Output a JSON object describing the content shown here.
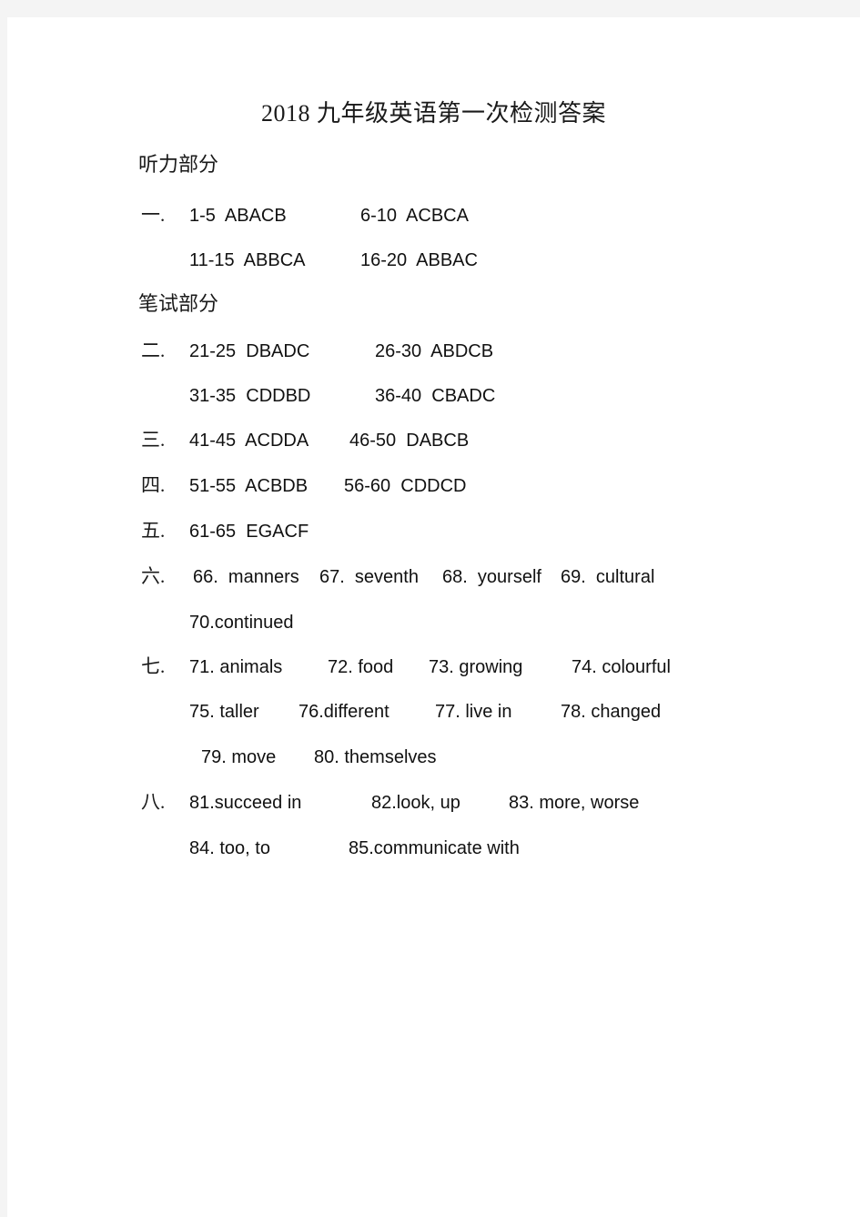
{
  "document": {
    "title": "2018 九年级英语第一次检测答案",
    "page_background": "#ffffff",
    "frame_color": "#f4f4f4",
    "text_color": "#111111"
  },
  "sections": {
    "listening_heading": "听力部分",
    "written_heading": "笔试部分"
  },
  "markers": {
    "one": "一.",
    "two": "二.",
    "three": "三.",
    "four": "四.",
    "five": "五.",
    "six": "六.",
    "seven": "七.",
    "eight": "八."
  },
  "part1": {
    "row1_col1": "1-5  ABACB",
    "row1_col2": "6-10  ACBCA",
    "row2_col1": "11-15  ABBCA",
    "row2_col2": "16-20  ABBAC"
  },
  "part2": {
    "row1_col1": "21-25  DBADC",
    "row1_col2": "26-30  ABDCB",
    "row2_col1": "31-35  CDDBD",
    "row2_col2": "36-40  CBADC"
  },
  "part3": {
    "col1": "41-45  ACDDA",
    "col2": "46-50  DABCB"
  },
  "part4": {
    "col1": "51-55  ACBDB",
    "col2": "56-60  CDDCD"
  },
  "part5": {
    "col1": "61-65  EGACF"
  },
  "part6": {
    "row1_item1": "66.  manners",
    "row1_item2": "67.  seventh",
    "row1_item3": "68.  yourself",
    "row1_item4": "69.  cultural",
    "row2_item1": "70.continued"
  },
  "part7": {
    "row1_item1": "71. animals",
    "row1_item2": "72. food",
    "row1_item3": "73. growing",
    "row1_item4": "74. colourful",
    "row2_item1": "75. taller",
    "row2_item2": "76.different",
    "row2_item3": "77. live in",
    "row2_item4": "78. changed",
    "row3_item1": "79. move",
    "row3_item2": "80. themselves"
  },
  "part8": {
    "row1_item1": "81.succeed in",
    "row1_item2": "82.look, up",
    "row1_item3": "83. more, worse",
    "row2_item1": "84. too, to",
    "row2_item2": "85.communicate with"
  }
}
